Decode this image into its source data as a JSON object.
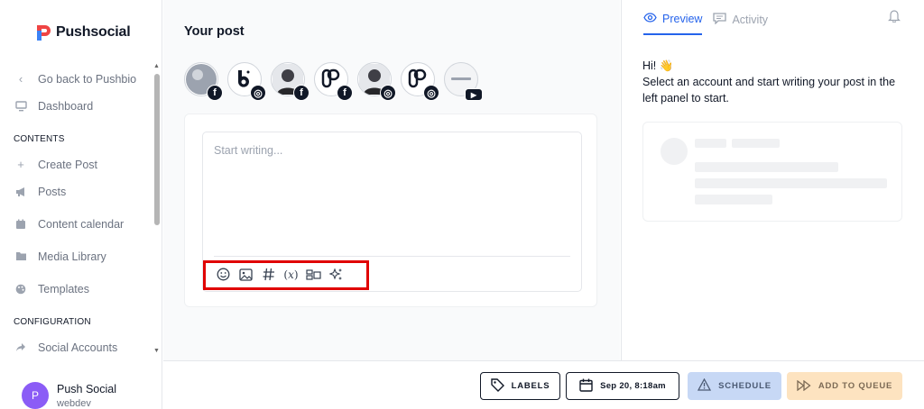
{
  "brand": {
    "name": "Pushsocial"
  },
  "sidebar": {
    "back_label": "Go back to Pushbio",
    "dashboard_label": "Dashboard",
    "contents_heading": "CONTENTS",
    "contents_items": [
      {
        "label": "Create Post",
        "icon": "plus-icon"
      },
      {
        "label": "Posts",
        "icon": "megaphone-icon"
      },
      {
        "label": "Content calendar",
        "icon": "calendar-icon"
      },
      {
        "label": "Media Library",
        "icon": "folder-icon"
      },
      {
        "label": "Templates",
        "icon": "palette-icon"
      }
    ],
    "config_heading": "CONFIGURATION",
    "config_items": [
      {
        "label": "Social Accounts",
        "icon": "share-icon"
      }
    ],
    "user": {
      "initial": "P",
      "name": "Push Social",
      "org": "webdev"
    }
  },
  "main": {
    "title": "Your post",
    "accounts": [
      {
        "network": "facebook",
        "badge": "f"
      },
      {
        "network": "instagram",
        "badge": "◎"
      },
      {
        "network": "facebook",
        "badge": "f"
      },
      {
        "network": "facebook",
        "badge": "f"
      },
      {
        "network": "instagram",
        "badge": "◎"
      },
      {
        "network": "instagram",
        "badge": "◎"
      },
      {
        "network": "youtube",
        "badge": "▶"
      }
    ],
    "editor": {
      "placeholder": "Start writing...",
      "tools": [
        "emoji-icon",
        "image-icon",
        "hashtag-icon",
        "variable-icon",
        "layout-icon",
        "sparkles-icon"
      ]
    }
  },
  "preview": {
    "tabs": [
      {
        "label": "Preview",
        "active": true
      },
      {
        "label": "Activity",
        "active": false
      }
    ],
    "greeting": "Hi! 👋",
    "message": "Select an account and start writing your post in the left panel to start."
  },
  "footer": {
    "labels_btn": "LABELS",
    "date_btn": "Sep 20, 8:18am",
    "schedule_btn": "SCHEDULE",
    "queue_btn": "ADD TO QUEUE"
  },
  "colors": {
    "accent": "#2563eb",
    "avatar": "#8b5cf6",
    "highlight": "#e00000"
  }
}
